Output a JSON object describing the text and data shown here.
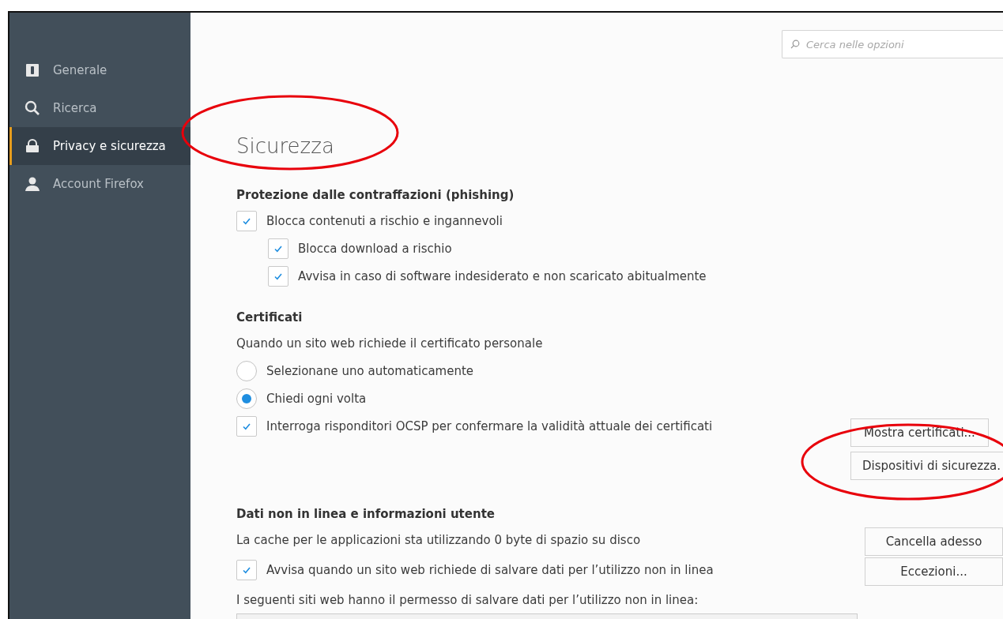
{
  "sidebar": {
    "items": [
      {
        "kind": "general",
        "label": "Generale",
        "selected": false
      },
      {
        "kind": "search",
        "label": "Ricerca",
        "selected": false
      },
      {
        "kind": "privacy",
        "label": "Privacy e sicurezza",
        "selected": true
      },
      {
        "kind": "account",
        "label": "Account Firefox",
        "selected": false
      }
    ]
  },
  "search": {
    "placeholder": "Cerca nelle opzioni"
  },
  "title": "Sicurezza",
  "sections": [
    {
      "heading": "Protezione dalle contraffazioni (phishing)",
      "items": [
        {
          "kind": "checkbox",
          "label": "Blocca contenuti a rischio e ingannevoli",
          "checked": true,
          "children": [
            {
              "kind": "checkbox",
              "label": "Blocca download a rischio",
              "checked": true
            },
            {
              "kind": "checkbox",
              "label": "Avvisa in caso di software indesiderato e non scaricato abitualmente",
              "checked": true
            }
          ]
        }
      ]
    },
    {
      "heading": "Certificati",
      "items": [
        {
          "kind": "text",
          "label": "Quando un sito web richiede il certificato personale"
        },
        {
          "kind": "radio",
          "label": "Selezionane uno automaticamente",
          "selected": false
        },
        {
          "kind": "radio",
          "label": "Chiedi ogni volta",
          "selected": true
        },
        {
          "kind": "checkbox",
          "label": "Interroga risponditori OCSP per confermare la validità attuale dei certificati",
          "checked": true,
          "buttons": [
            "Mostra certificati...",
            "Dispositivi di sicurezza."
          ]
        }
      ]
    },
    {
      "heading": "Dati non in linea e informazioni utente",
      "items": [
        {
          "kind": "text",
          "label": "La cache per le applicazioni sta utilizzando 0 byte di spazio su disco",
          "buttons": [
            "Cancella adesso"
          ]
        },
        {
          "kind": "checkbox",
          "label": "Avvisa quando un sito web richiede di salvare dati per l’utilizzo non in linea",
          "checked": true,
          "buttons": [
            "Eccezioni..."
          ]
        },
        {
          "kind": "text",
          "label": "I seguenti siti web hanno il permesso di salvare dati per l’utilizzo non in linea:",
          "list": true
        }
      ]
    }
  ]
}
